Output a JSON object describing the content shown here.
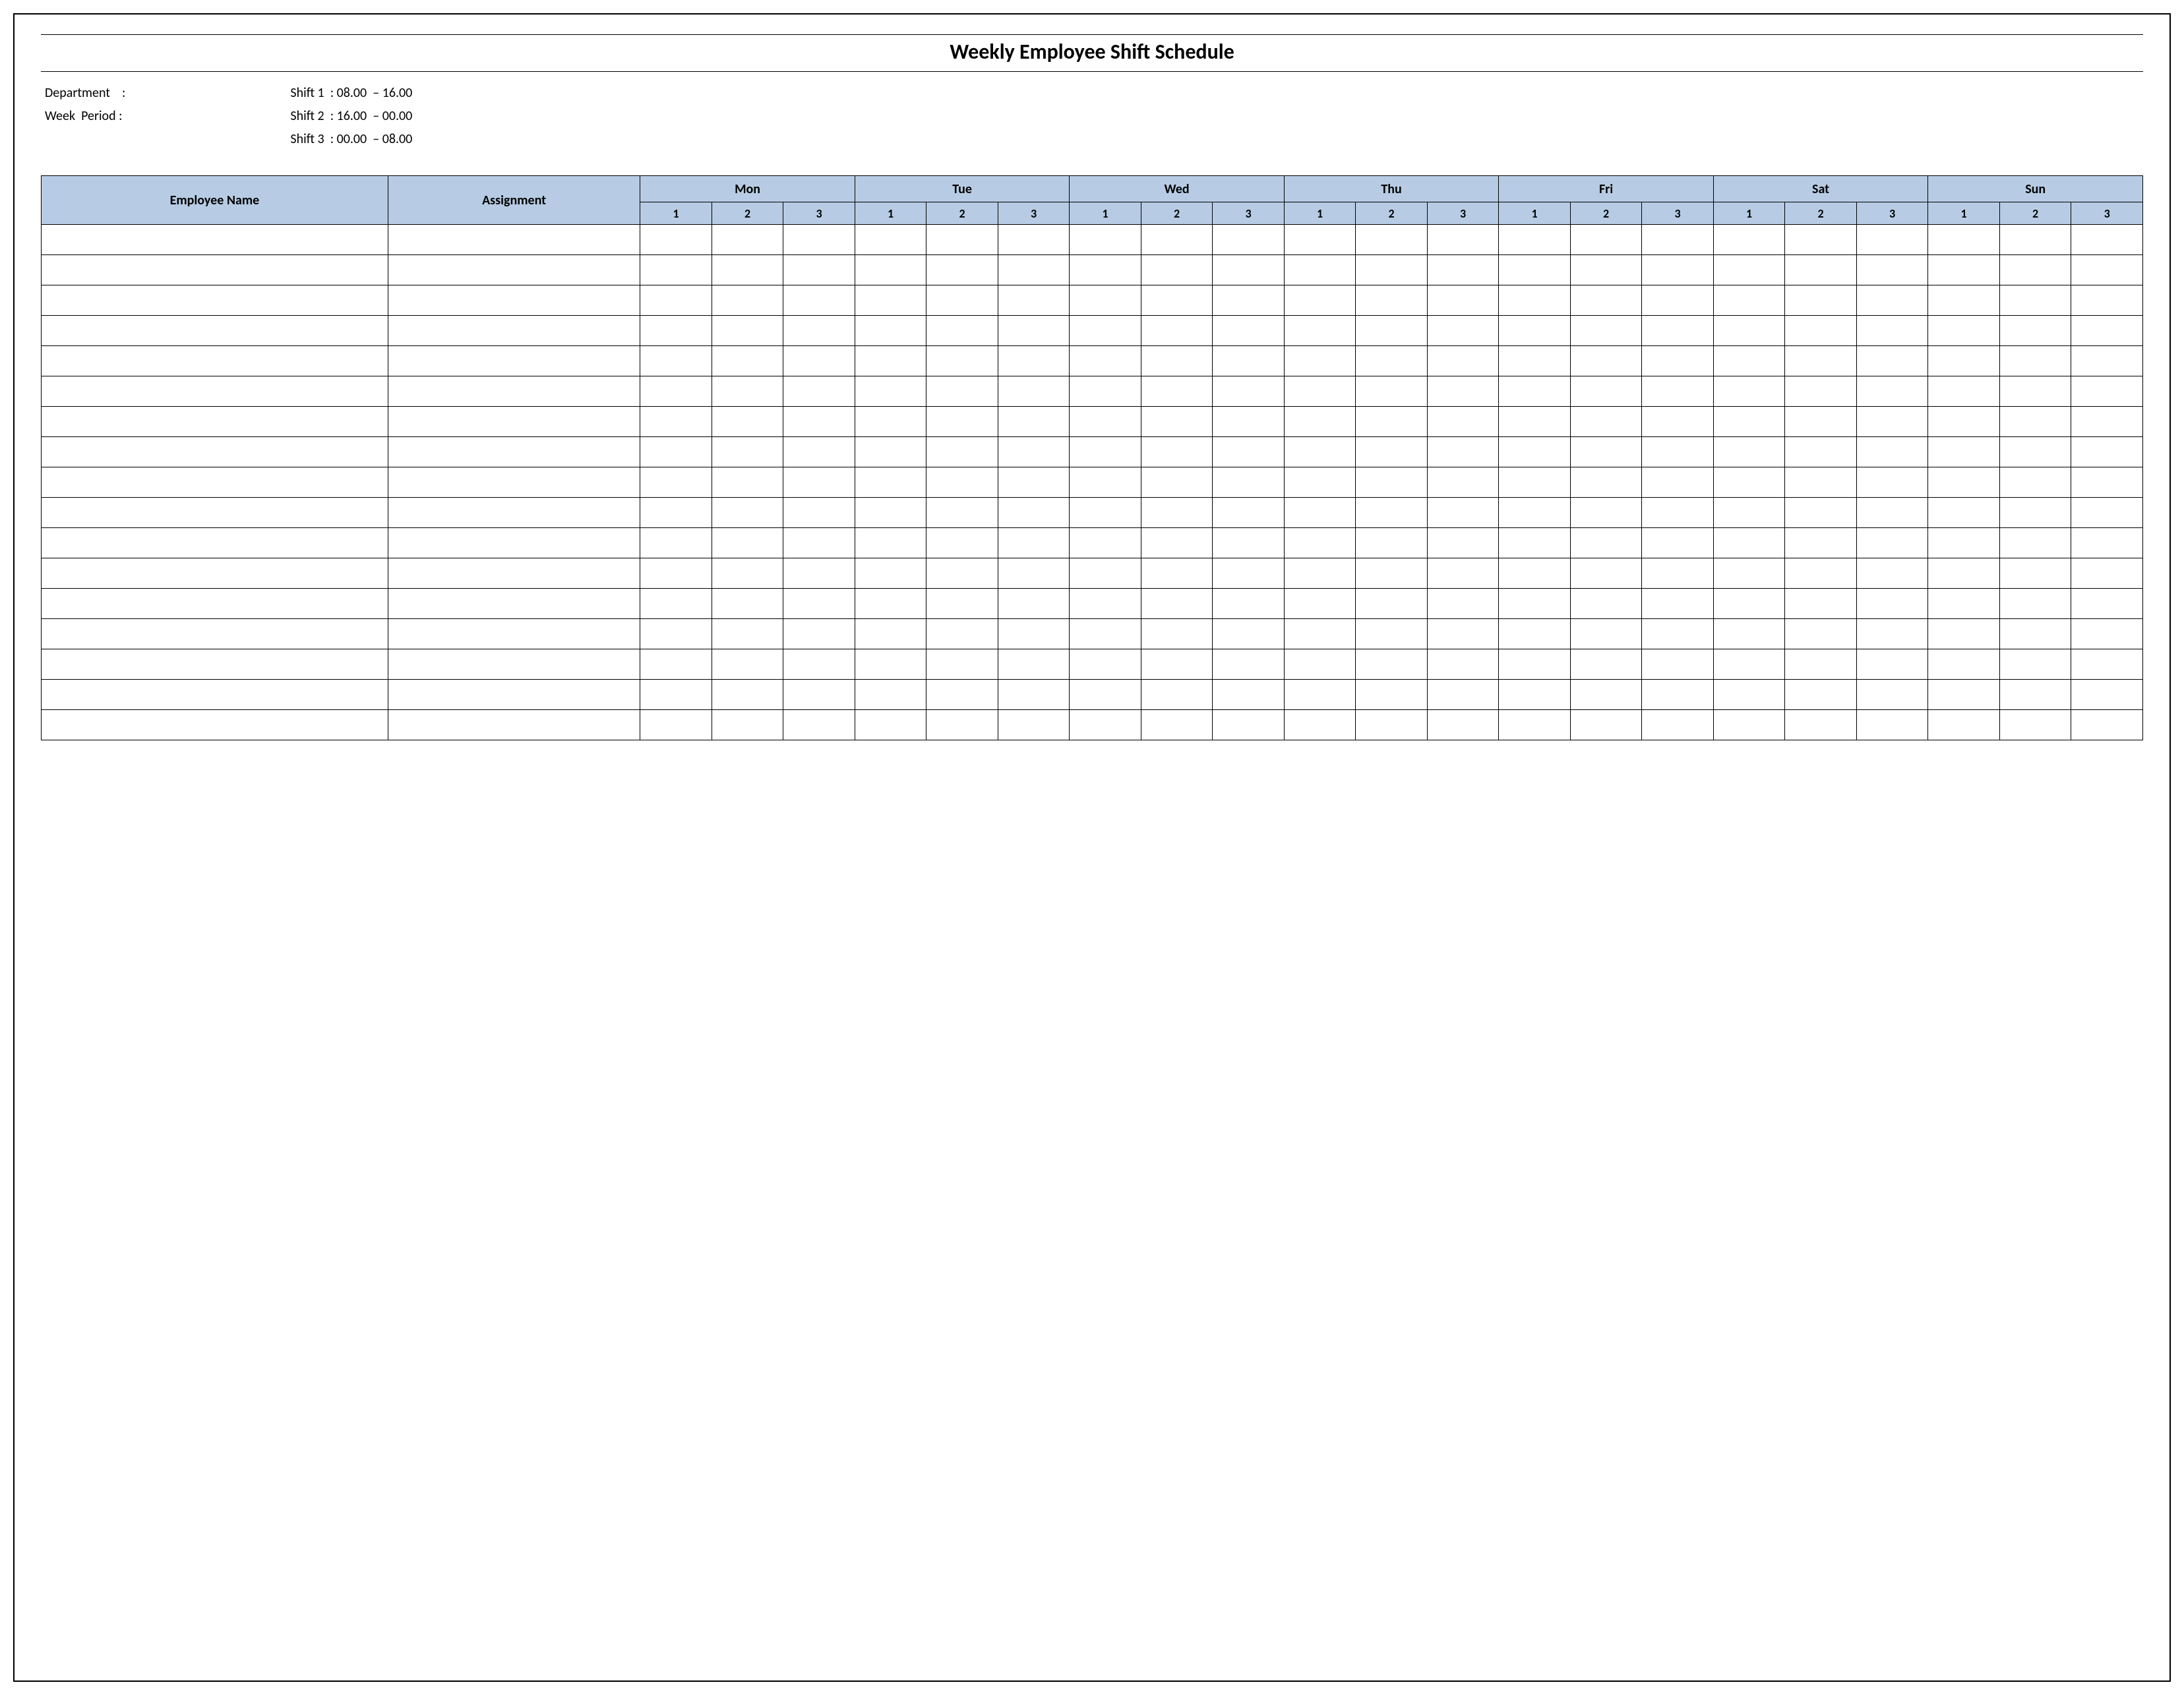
{
  "title": "Weekly Employee Shift Schedule",
  "meta": {
    "department_label": "Department    :",
    "week_period_label": "Week  Period :",
    "shift1": "Shift 1  : 08.00  – 16.00",
    "shift2": "Shift 2  : 16.00  – 00.00",
    "shift3": "Shift 3  : 00.00  – 08.00"
  },
  "headers": {
    "employee": "Employee Name",
    "assignment": "Assignment",
    "days": [
      "Mon",
      "Tue",
      "Wed",
      "Thu",
      "Fri",
      "Sat",
      "Sun"
    ],
    "shifts": [
      "1",
      "2",
      "3"
    ]
  },
  "rows": [
    {
      "name": "",
      "assignment": "",
      "cells": [
        "",
        "",
        "",
        "",
        "",
        "",
        "",
        "",
        "",
        "",
        "",
        "",
        "",
        "",
        "",
        "",
        "",
        "",
        "",
        "",
        ""
      ]
    },
    {
      "name": "",
      "assignment": "",
      "cells": [
        "",
        "",
        "",
        "",
        "",
        "",
        "",
        "",
        "",
        "",
        "",
        "",
        "",
        "",
        "",
        "",
        "",
        "",
        "",
        "",
        ""
      ]
    },
    {
      "name": "",
      "assignment": "",
      "cells": [
        "",
        "",
        "",
        "",
        "",
        "",
        "",
        "",
        "",
        "",
        "",
        "",
        "",
        "",
        "",
        "",
        "",
        "",
        "",
        "",
        ""
      ]
    },
    {
      "name": "",
      "assignment": "",
      "cells": [
        "",
        "",
        "",
        "",
        "",
        "",
        "",
        "",
        "",
        "",
        "",
        "",
        "",
        "",
        "",
        "",
        "",
        "",
        "",
        "",
        ""
      ]
    },
    {
      "name": "",
      "assignment": "",
      "cells": [
        "",
        "",
        "",
        "",
        "",
        "",
        "",
        "",
        "",
        "",
        "",
        "",
        "",
        "",
        "",
        "",
        "",
        "",
        "",
        "",
        ""
      ]
    },
    {
      "name": "",
      "assignment": "",
      "cells": [
        "",
        "",
        "",
        "",
        "",
        "",
        "",
        "",
        "",
        "",
        "",
        "",
        "",
        "",
        "",
        "",
        "",
        "",
        "",
        "",
        ""
      ]
    },
    {
      "name": "",
      "assignment": "",
      "cells": [
        "",
        "",
        "",
        "",
        "",
        "",
        "",
        "",
        "",
        "",
        "",
        "",
        "",
        "",
        "",
        "",
        "",
        "",
        "",
        "",
        ""
      ]
    },
    {
      "name": "",
      "assignment": "",
      "cells": [
        "",
        "",
        "",
        "",
        "",
        "",
        "",
        "",
        "",
        "",
        "",
        "",
        "",
        "",
        "",
        "",
        "",
        "",
        "",
        "",
        ""
      ]
    },
    {
      "name": "",
      "assignment": "",
      "cells": [
        "",
        "",
        "",
        "",
        "",
        "",
        "",
        "",
        "",
        "",
        "",
        "",
        "",
        "",
        "",
        "",
        "",
        "",
        "",
        "",
        ""
      ]
    },
    {
      "name": "",
      "assignment": "",
      "cells": [
        "",
        "",
        "",
        "",
        "",
        "",
        "",
        "",
        "",
        "",
        "",
        "",
        "",
        "",
        "",
        "",
        "",
        "",
        "",
        "",
        ""
      ]
    },
    {
      "name": "",
      "assignment": "",
      "cells": [
        "",
        "",
        "",
        "",
        "",
        "",
        "",
        "",
        "",
        "",
        "",
        "",
        "",
        "",
        "",
        "",
        "",
        "",
        "",
        "",
        ""
      ]
    },
    {
      "name": "",
      "assignment": "",
      "cells": [
        "",
        "",
        "",
        "",
        "",
        "",
        "",
        "",
        "",
        "",
        "",
        "",
        "",
        "",
        "",
        "",
        "",
        "",
        "",
        "",
        ""
      ]
    },
    {
      "name": "",
      "assignment": "",
      "cells": [
        "",
        "",
        "",
        "",
        "",
        "",
        "",
        "",
        "",
        "",
        "",
        "",
        "",
        "",
        "",
        "",
        "",
        "",
        "",
        "",
        ""
      ]
    },
    {
      "name": "",
      "assignment": "",
      "cells": [
        "",
        "",
        "",
        "",
        "",
        "",
        "",
        "",
        "",
        "",
        "",
        "",
        "",
        "",
        "",
        "",
        "",
        "",
        "",
        "",
        ""
      ]
    },
    {
      "name": "",
      "assignment": "",
      "cells": [
        "",
        "",
        "",
        "",
        "",
        "",
        "",
        "",
        "",
        "",
        "",
        "",
        "",
        "",
        "",
        "",
        "",
        "",
        "",
        "",
        ""
      ]
    },
    {
      "name": "",
      "assignment": "",
      "cells": [
        "",
        "",
        "",
        "",
        "",
        "",
        "",
        "",
        "",
        "",
        "",
        "",
        "",
        "",
        "",
        "",
        "",
        "",
        "",
        "",
        ""
      ]
    },
    {
      "name": "",
      "assignment": "",
      "cells": [
        "",
        "",
        "",
        "",
        "",
        "",
        "",
        "",
        "",
        "",
        "",
        "",
        "",
        "",
        "",
        "",
        "",
        "",
        "",
        "",
        ""
      ]
    }
  ]
}
